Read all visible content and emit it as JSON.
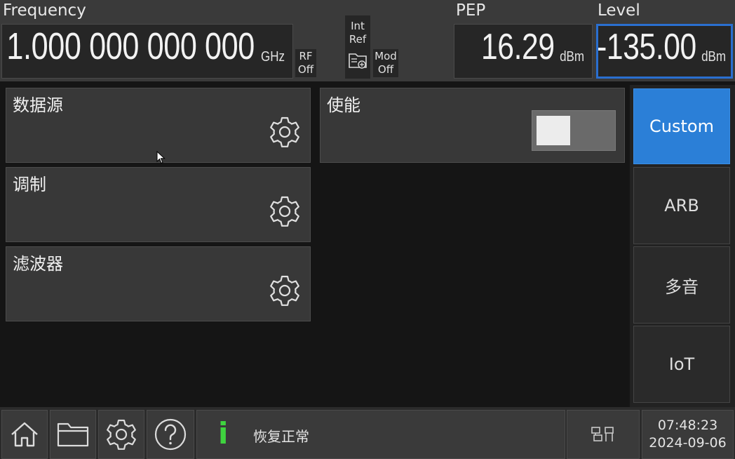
{
  "header": {
    "frequency_label": "Frequency",
    "frequency_value": "1.000 000 000 000",
    "frequency_unit": "GHz",
    "rf_label": "RF",
    "rf_state": "Off",
    "ref_line1": "Int",
    "ref_line2": "Ref",
    "mod_label": "Mod",
    "mod_state": "Off",
    "pep_label": "PEP",
    "pep_value": "16.29",
    "pep_unit": "dBm",
    "level_label": "Level",
    "level_value": "-135.00",
    "level_unit": "dBm"
  },
  "panels": {
    "data_source": "数据源",
    "modulation": "调制",
    "filter": "滤波器",
    "enable": "使能"
  },
  "menu": {
    "items": [
      "Custom",
      "ARB",
      "多音",
      "IoT"
    ],
    "active": "Custom"
  },
  "footer": {
    "status_text": "恢复正常",
    "info_glyph": "i",
    "time": "07:48:23",
    "date": "2024-09-06"
  },
  "colors": {
    "accent": "#2b7fd7",
    "info_green": "#3fd43f",
    "level_border": "#2a6fd0"
  }
}
